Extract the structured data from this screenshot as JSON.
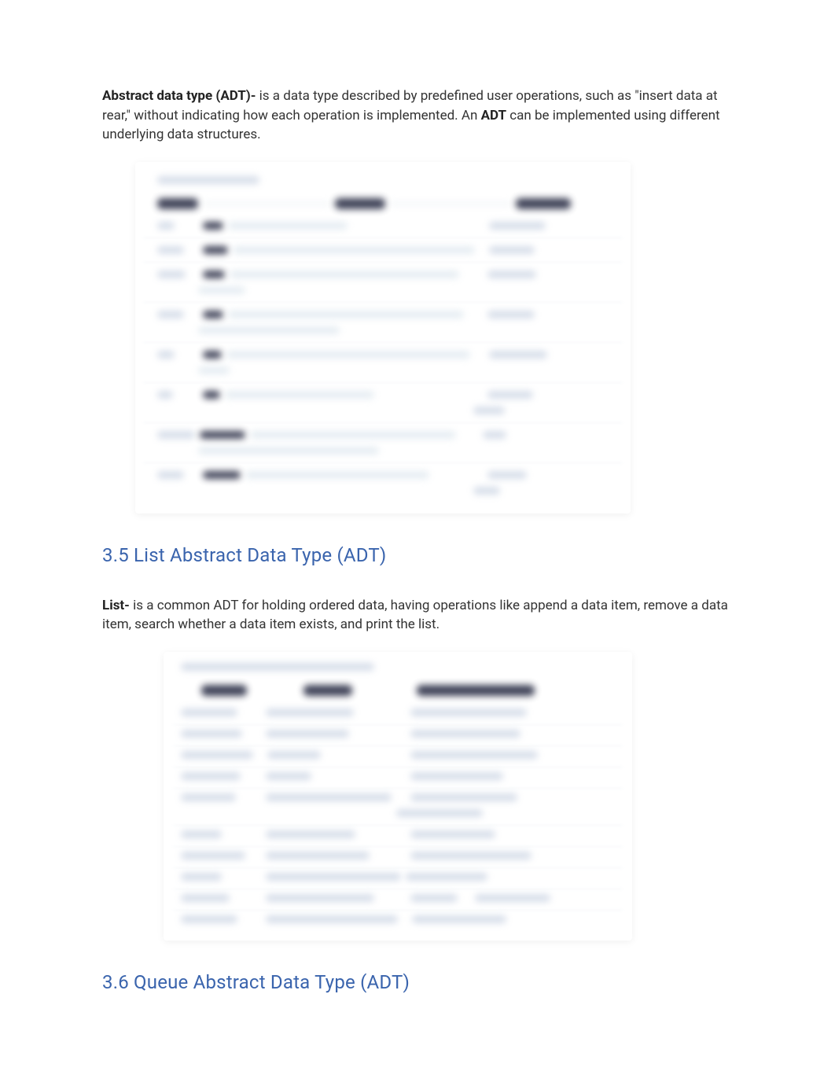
{
  "intro": {
    "adt_label": "Abstract data type (ADT)- ",
    "adt_text1": "is a data type described by predefined user operations, such as \"insert data at rear,\" without indicating how each operation is implemented. An ",
    "adt_bold2": "ADT",
    "adt_text2": " can be implemented using different underlying data structures."
  },
  "section35": {
    "title": "3.5 List Abstract Data Type (ADT)",
    "list_label": "List- ",
    "list_text": "is a common ADT for holding ordered data, having operations like append a data item, remove a data item, search whether a data item exists, and print the list."
  },
  "section36": {
    "title": "3.6 Queue Abstract Data Type (ADT)"
  }
}
